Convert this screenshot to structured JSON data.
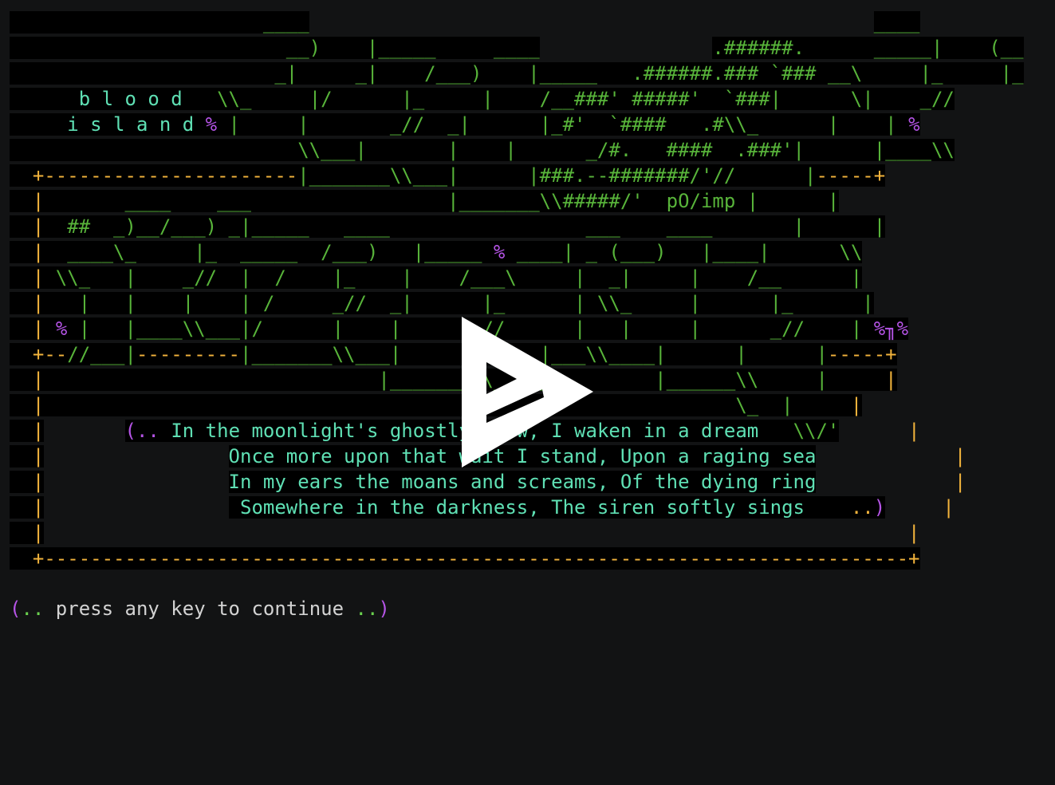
{
  "art": {
    "rows": [
      [
        {
          "t": "                      ____",
          "c": "g",
          "bg": true
        },
        {
          "t": "                                                 ",
          "c": "g"
        },
        {
          "t": "____",
          "c": "g",
          "bg": true
        }
      ],
      [
        {
          "t": "                        __)    |_____     ____",
          "c": "g",
          "bg": true
        },
        {
          "t": "               ",
          "c": "g"
        },
        {
          "t": ".######.      _____|    (__",
          "c": "g",
          "bg": true
        }
      ],
      [
        {
          "t": "                       _|     _|    /___)    |_____   .######.### `### __\\     |_     |_",
          "c": "g",
          "bg": true
        }
      ],
      [
        {
          "t": "      ",
          "c": "g",
          "bg": true
        },
        {
          "t": "b l o o d",
          "c": "t",
          "bg": true
        },
        {
          "t": "   \\\\_     |/      |_     |    /__###' #####'  `###|      \\|    _//",
          "c": "g",
          "bg": true
        }
      ],
      [
        {
          "t": "     ",
          "c": "g",
          "bg": true
        },
        {
          "t": "i s l a n d",
          "c": "t",
          "bg": true
        },
        {
          "t": " ",
          "c": "g",
          "bg": true
        },
        {
          "t": "%",
          "c": "p",
          "bg": true
        },
        {
          "t": " |     |       _//  _|      |_#'  `####   .#\\\\_      |    |",
          "c": "g",
          "bg": true
        },
        {
          "t": " %",
          "c": "p",
          "bg": true
        }
      ],
      [
        {
          "t": "                         \\\\___|       |    |      _/#.   ####  .###'|      |____\\\\",
          "c": "g",
          "bg": true
        }
      ],
      [
        {
          "t": "  +----------------------",
          "c": "y",
          "bg": true
        },
        {
          "t": "|_______\\\\___|",
          "c": "g",
          "bg": true
        },
        {
          "t": "      |###.--#######/'//",
          "c": "g",
          "bg": true
        },
        {
          "t": "      |",
          "c": "g",
          "bg": true
        },
        {
          "t": "-----+",
          "c": "y",
          "bg": true
        }
      ],
      [
        {
          "t": "  |",
          "c": "y",
          "bg": true
        },
        {
          "t": "       ____    ___",
          "c": "g",
          "bg": true
        },
        {
          "t": "                 |_______\\\\#####/'  pO/imp |      |",
          "c": "g",
          "bg": true
        }
      ],
      [
        {
          "t": "  |",
          "c": "y",
          "bg": true
        },
        {
          "t": "  ##  _)__/___) _|_____   ____",
          "c": "g",
          "bg": true
        },
        {
          "t": "                 ___    ____       |      |",
          "c": "g",
          "bg": true
        }
      ],
      [
        {
          "t": "  |",
          "c": "y",
          "bg": true
        },
        {
          "t": "  ____\\_     |_  _____  /___)   |_____ ",
          "c": "g",
          "bg": true
        },
        {
          "t": "%",
          "c": "p",
          "bg": true
        },
        {
          "t": " ____| _ (___)   |____|      \\\\",
          "c": "g",
          "bg": true
        }
      ],
      [
        {
          "t": "  |",
          "c": "y",
          "bg": true
        },
        {
          "t": " \\\\_   |    _//  |  /    |_    |    /___\\     |  _|     |    /__      |",
          "c": "g",
          "bg": true
        }
      ],
      [
        {
          "t": "  |",
          "c": "y",
          "bg": true
        },
        {
          "t": "   |   |    |    | /     _//  _|      |_      | \\\\_     |      |_      |",
          "c": "g",
          "bg": true
        }
      ],
      [
        {
          "t": "  |",
          "c": "y",
          "bg": true
        },
        {
          "t": " ",
          "c": "g",
          "bg": true
        },
        {
          "t": "%",
          "c": "p",
          "bg": true
        },
        {
          "t": " |   |____\\\\___|/      |    |      _//      |   |     |      _//    |",
          "c": "g",
          "bg": true
        },
        {
          "t": " %",
          "c": "p",
          "bg": true
        },
        {
          "t": "╖",
          "c": "p",
          "bg": true
        },
        {
          "t": "%",
          "c": "p",
          "bg": true
        }
      ],
      [
        {
          "t": "  +--",
          "c": "y",
          "bg": true
        },
        {
          "t": "//___|",
          "c": "g",
          "bg": true
        },
        {
          "t": "---------",
          "c": "y",
          "bg": true
        },
        {
          "t": "|_______\\\\___|",
          "c": "g",
          "bg": true
        },
        {
          "t": "      |     |___\\\\____|      |      |",
          "c": "g",
          "bg": true
        },
        {
          "t": "-----+",
          "c": "y",
          "bg": true
        }
      ],
      [
        {
          "t": "  |",
          "c": "y",
          "bg": true
        },
        {
          "t": "                             |_______\\\\_____|        |______\\\\     |",
          "c": "g",
          "bg": true
        },
        {
          "t": "     |",
          "c": "y",
          "bg": true
        }
      ],
      [
        {
          "t": "  |",
          "c": "y",
          "bg": true
        },
        {
          "t": "                                                            \\_  |",
          "c": "g",
          "bg": true
        },
        {
          "t": "     |",
          "c": "y",
          "bg": true
        }
      ],
      [
        {
          "t": "  |",
          "c": "y",
          "bg": true
        },
        {
          "t": "       ",
          "c": "g"
        },
        {
          "t": "(..",
          "c": "p",
          "bg": true
        },
        {
          "t": " In the moonlight's ghostly glow, I waken in a dream",
          "c": "t",
          "bg": true
        },
        {
          "t": "   \\\\/'",
          "c": "g",
          "bg": true
        },
        {
          "t": "      |",
          "c": "y"
        }
      ],
      [
        {
          "t": "  |",
          "c": "y",
          "bg": true
        },
        {
          "t": "                ",
          "c": "t"
        },
        {
          "t": "Once more upon that wait I stand, Upon a raging sea",
          "c": "t",
          "bg": true
        },
        {
          "t": "            |",
          "c": "y"
        }
      ],
      [
        {
          "t": "  |",
          "c": "y",
          "bg": true
        },
        {
          "t": "                ",
          "c": "t"
        },
        {
          "t": "In my ears the moans and screams, Of the dying ring",
          "c": "t",
          "bg": true
        },
        {
          "t": "            |",
          "c": "y"
        }
      ],
      [
        {
          "t": "  |",
          "c": "y",
          "bg": true
        },
        {
          "t": "                ",
          "c": "t"
        },
        {
          "t": " Somewhere in the darkness, The siren softly sings",
          "c": "t",
          "bg": true
        },
        {
          "t": "    ..",
          "c": "y",
          "bg": true
        },
        {
          "t": ")",
          "c": "p",
          "bg": true
        },
        {
          "t": "     |",
          "c": "y"
        }
      ],
      [
        {
          "t": "  |",
          "c": "y",
          "bg": true
        },
        {
          "t": "                                                                           |",
          "c": "y"
        }
      ],
      [
        {
          "t": "  +---------------------------------------------------------------------------+",
          "c": "y",
          "bg": true
        }
      ]
    ]
  },
  "prompt": {
    "open_paren": "(",
    "open_dots": "..",
    "text": " press any key to continue ",
    "close_dots": "..",
    "close_paren": ")"
  },
  "overlay": {
    "icon": "play-logo-icon"
  },
  "colors": {
    "background": "#121314",
    "green": "#58b43a",
    "teal": "#5fe0b4",
    "yellow": "#f2b33c",
    "purple": "#b554e6",
    "white": "#d3d3d3"
  }
}
